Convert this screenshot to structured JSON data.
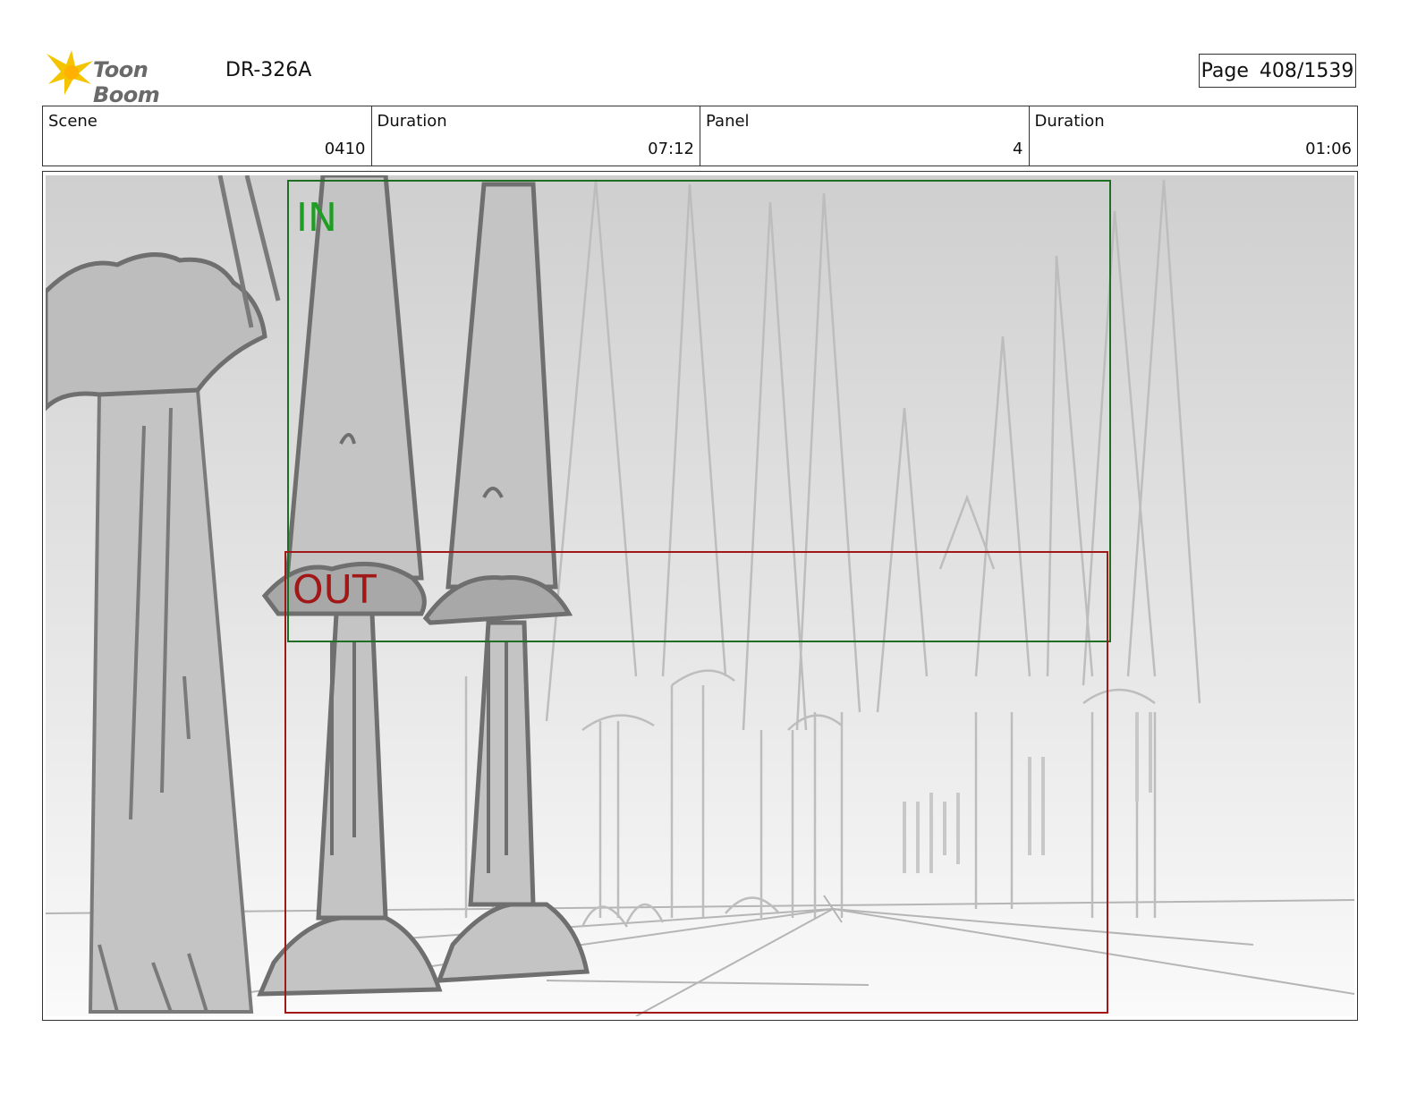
{
  "header": {
    "logo_text": "Toon Boom",
    "production_code": "DR-326A",
    "page_label": "Page",
    "page_number": "408/1539"
  },
  "info": {
    "scene_label": "Scene",
    "scene_value": "0410",
    "scene_duration_label": "Duration",
    "scene_duration_value": "07:12",
    "panel_label": "Panel",
    "panel_value": "4",
    "panel_duration_label": "Duration",
    "panel_duration_value": "01:06"
  },
  "frames": {
    "in_label": "IN",
    "out_label": "OUT",
    "in_color": "#1f6e24",
    "out_color": "#a01818"
  },
  "colors": {
    "logo_star": "#f5c400",
    "sketch_dark": "#777777",
    "sketch_light": "#b8b8b8"
  }
}
